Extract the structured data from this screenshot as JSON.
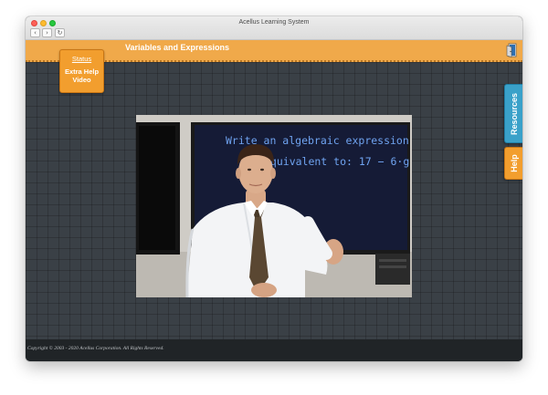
{
  "window": {
    "title": "Acellus Learning System",
    "nav": {
      "back": "‹",
      "forward": "›",
      "reload": "↻"
    }
  },
  "header": {
    "lesson_title": "Variables and Expressions",
    "exit_icon": "exit-door-icon"
  },
  "status": {
    "link_label": "Status",
    "value": "Extra Help Video"
  },
  "side_tabs": {
    "resources": "Resources",
    "help": "Help"
  },
  "video": {
    "board_line1": "Write an algebraic expression",
    "board_line2": "equivalent to:  17 − 6·g"
  },
  "footer": {
    "copyright": "Copyright © 2003 - 2020 Acellus Corporation. All Rights Reserved."
  },
  "colors": {
    "accent_orange": "#f0a94a",
    "resources_blue": "#3aa1c9",
    "chalk_blue": "#6fa3f0"
  }
}
